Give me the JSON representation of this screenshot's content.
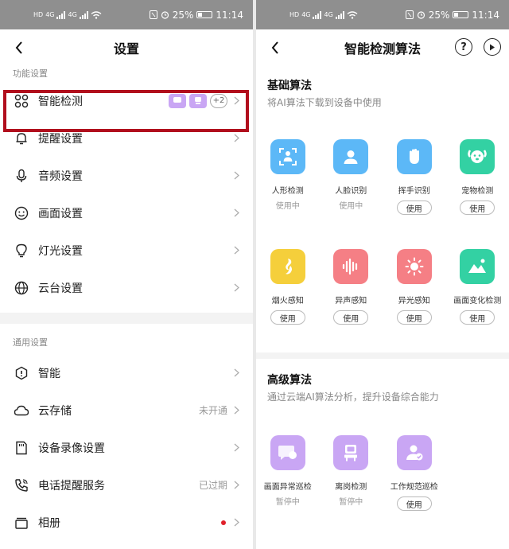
{
  "status_bar": {
    "time": "11:14",
    "battery": "25%",
    "hd1": "HD",
    "hd2": "HD",
    "net": "4G"
  },
  "left": {
    "title": "设置",
    "section_function": "功能设置",
    "smart_detect": {
      "label": "智能检测",
      "plus": "+2"
    },
    "function_items": [
      {
        "label": "提醒设置"
      },
      {
        "label": "音频设置"
      },
      {
        "label": "画面设置"
      },
      {
        "label": "灯光设置"
      },
      {
        "label": "云台设置"
      }
    ],
    "section_general": "通用设置",
    "general_items": [
      {
        "label": "智能",
        "value": ""
      },
      {
        "label": "云存储",
        "value": "未开通"
      },
      {
        "label": "设备录像设置",
        "value": ""
      },
      {
        "label": "电话提醒服务",
        "value": "已过期"
      },
      {
        "label": "相册",
        "value": ""
      }
    ]
  },
  "right": {
    "title": "智能检测算法",
    "help_glyph": "?",
    "basic": {
      "title": "基础算法",
      "subtitle": "将AI算法下载到设备中使用",
      "items": [
        {
          "name": "人形检测",
          "status": "使用中",
          "color": "#5cb8f7",
          "icon": "person-detect-icon"
        },
        {
          "name": "人脸识别",
          "status": "使用中",
          "color": "#5cb8f7",
          "icon": "face-icon"
        },
        {
          "name": "挥手识别",
          "status": "使用",
          "color": "#5cb8f7",
          "icon": "hand-icon"
        },
        {
          "name": "宠物检测",
          "status": "使用",
          "color": "#33d1a3",
          "icon": "pet-icon"
        },
        {
          "name": "烟火感知",
          "status": "使用",
          "color": "#f5cf3b",
          "icon": "fire-icon"
        },
        {
          "name": "异声感知",
          "status": "使用",
          "color": "#f57f85",
          "icon": "sound-icon"
        },
        {
          "name": "异光感知",
          "status": "使用",
          "color": "#f57f85",
          "icon": "light-icon"
        },
        {
          "name": "画面变化检测",
          "status": "使用",
          "color": "#33d1a3",
          "icon": "image-change-icon"
        }
      ]
    },
    "advanced": {
      "title": "高级算法",
      "subtitle": "通过云端AI算法分析，提升设备综合能力",
      "items": [
        {
          "name": "画面异常巡检",
          "status": "暂停中",
          "color": "#c9a6f4",
          "icon": "chat-icon"
        },
        {
          "name": "离岗检测",
          "status": "暂停中",
          "color": "#c9a6f4",
          "icon": "seat-icon"
        },
        {
          "name": "工作规范巡检",
          "status": "使用",
          "color": "#c9a6f4",
          "icon": "worker-icon"
        }
      ]
    }
  }
}
